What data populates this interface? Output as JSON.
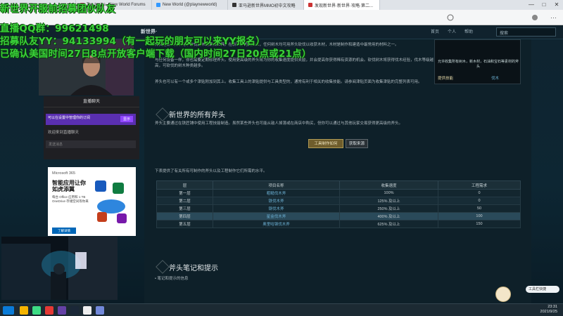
{
  "browser": {
    "tabs": [
      {
        "label": "斧头·新世界"
      },
      {
        "label": "Top topics - New World Forums"
      },
      {
        "label": "New World (@playnewworld)"
      },
      {
        "label": "亚马逊新世界MMO初中文攻略"
      },
      {
        "label": "发现新世界·新世界·攻略·第二..."
      }
    ],
    "window_controls": [
      "—",
      "□",
      "✕"
    ]
  },
  "site": {
    "brand": "新世界·",
    "nav": [
      "首页",
      "个人",
      "帮助"
    ],
    "search_placeholder": "搜索"
  },
  "overlay": {
    "line1": "新世界开服前招募团伙队友",
    "line2": "直播QQ群：99621498",
    "line3": "招募队友YY：94133994（有一起玩的朋友可以来YY报名）",
    "line4": "已确认美国时间27日8点开放客户端下载（国内时间27日20点或21点）"
  },
  "article": {
    "intro": "斧头是新世界中用于砍伐树木的采集工具。在新世界的大陆上，任何树木均可用斧头砍伐以收获木材，木材是制作和建造中最常用的材料之一。",
    "para1": "与任何设备一样，你也需要定期修理斧头。使用更高级的斧头将为你的收集速度提供奖励，并会提高你获得稀有资源的机会。砍伐树木将获得伐木经验，伐木等级越高，可砍伐的树木种类越多。",
    "para2": "斧头也可以有一个或多个津贴附加到其上。收集工具上的津贴提供与工具类型的，通常有利于相关的收集技能。请参阅津贴页面为收集津贴的完整列表可用。",
    "section_title": "新世界的所有斧头",
    "section_desc": "斧头主要通过在铁匠铺中使用工程技能制造。虽然某些斧头也可能从敌人掉落或在商店中购买，但你可以通过与其他玩家交易获得更高级的斧头。",
    "btn_craft": "工具制作如何",
    "btn_source": "获取来源",
    "table_caption": "下表提供了有关所有可制作的斧头以及工程制作它们所需的水平。",
    "notes_title": "斧头笔记和提示",
    "notes_item": "笔记和提示的信息"
  },
  "info_box": {
    "caption": "允许收集所有树木，新木材，石油和宝石等素材的斧头",
    "label": "提供技能",
    "value": "伐木"
  },
  "table": {
    "headers": [
      "层",
      "项目名称",
      "收集速度",
      "工程需求"
    ],
    "rows": [
      {
        "tier": "第一层",
        "name": "粗糙伐木斧",
        "speed": "100%",
        "req": "0"
      },
      {
        "tier": "第二层",
        "name": "铁伐木斧",
        "speed": "125% 及以上",
        "req": "0"
      },
      {
        "tier": "第三层",
        "name": "钢伐木斧",
        "speed": "250% 及以上",
        "req": "50"
      },
      {
        "tier": "第四层",
        "name": "星金伐木斧",
        "speed": "400% 及以上",
        "req": "100"
      },
      {
        "tier": "第五层",
        "name": "奥里哈钢伐木斧",
        "speed": "625% 及以上",
        "req": "150"
      }
    ]
  },
  "chat": {
    "header": "直播聊天",
    "notice": "可以在设置中管理你的订阅",
    "notice_btn": "显示",
    "line1": "欢迎来到直播聊天",
    "line2": "发送消息"
  },
  "ad": {
    "brand": "Microsoft 365",
    "title": "智能应用让你如虎添翼",
    "desc": "每台 Office 应用和 1 TB OneDrive 存储空间等你来",
    "cta": "了解详情"
  },
  "taskbar": {
    "time": "23:31",
    "date": "2021/9/25",
    "helper": "工具栏快捷"
  },
  "colors": {
    "overlay_text": "#3ad13a",
    "link": "#6cb0d3",
    "gold_button": "#6f5d2c"
  }
}
